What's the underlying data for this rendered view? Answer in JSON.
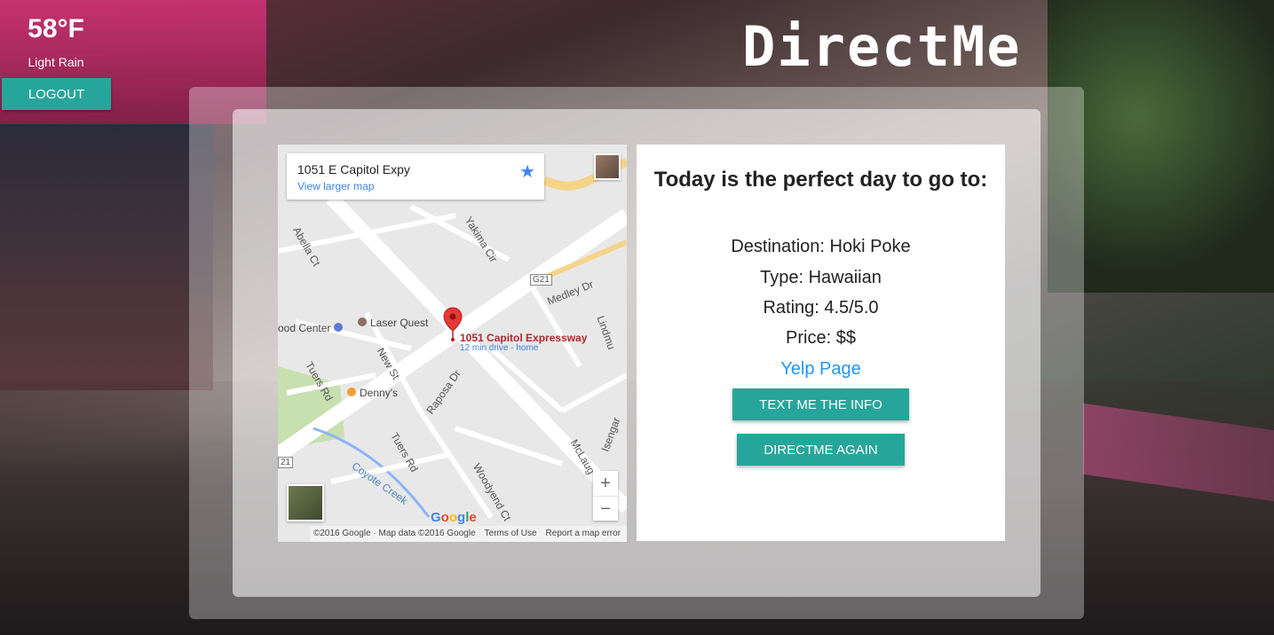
{
  "weather": {
    "temperature": "58°F",
    "condition": "Light Rain"
  },
  "header": {
    "logout_label": "LOGOUT",
    "logo": "DirectMe"
  },
  "map": {
    "card_title": "1051 E Capitol Expy",
    "card_link": "View larger map",
    "pin_label": "1051 Capitol Expressway",
    "pin_sublabel": "12 min drive - home",
    "places": [
      "Laser Quest",
      "Denny's",
      "ood Center"
    ],
    "streets": [
      "Abella Ct",
      "Yakima Cir",
      "Medley Dr",
      "Lindmu",
      "New St",
      "Tuers Rd",
      "Raposa Dr",
      "Tuers Rd",
      "Coyote Creek",
      "Woodyend Ct",
      "McLaug",
      "Isengar",
      "G21",
      "21"
    ],
    "zoom_in": "+",
    "zoom_out": "−",
    "footer": [
      "©2016 Google · Map data ©2016 Google",
      "Terms of Use",
      "Report a map error"
    ],
    "google_logo": "Google"
  },
  "info": {
    "title": "Today is the perfect day to go to:",
    "destination": "Destination: Hoki Poke",
    "type": "Type: Hawaiian",
    "rating": "Rating: 4.5/5.0",
    "price": "Price: $$",
    "yelp_link": "Yelp Page",
    "text_button": "TEXT ME THE INFO",
    "again_button": "DIRECTME AGAIN"
  },
  "colors": {
    "accent": "#26a69a",
    "link": "#2196f3",
    "pin": "#e53935"
  }
}
